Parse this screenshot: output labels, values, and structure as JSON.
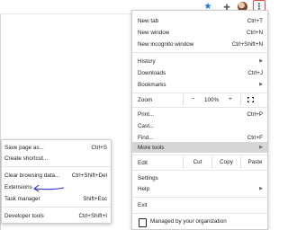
{
  "toolbar": {
    "icons": [
      "star-icon",
      "extensions-puzzle-icon",
      "profile-avatar",
      "kebab-menu-icon"
    ],
    "accent_color": "#1a73e8",
    "highlight_border_color": "#e05050"
  },
  "menu": {
    "new_tab": {
      "label": "New tab",
      "shortcut": "Ctrl+T"
    },
    "new_window": {
      "label": "New window",
      "shortcut": "Ctrl+N"
    },
    "new_incognito": {
      "label": "New incognito window",
      "shortcut": "Ctrl+Shift+N"
    },
    "history": {
      "label": "History"
    },
    "downloads": {
      "label": "Downloads",
      "shortcut": "Ctrl+J"
    },
    "bookmarks": {
      "label": "Bookmarks"
    },
    "zoom": {
      "label": "Zoom",
      "minus": "−",
      "value": "100%",
      "plus": "+"
    },
    "print": {
      "label": "Print...",
      "shortcut": "Ctrl+P"
    },
    "cast": {
      "label": "Cast..."
    },
    "find": {
      "label": "Find...",
      "shortcut": "Ctrl+F"
    },
    "more_tools": {
      "label": "More tools"
    },
    "edit": {
      "label": "Edit",
      "cut": "Cut",
      "copy": "Copy",
      "paste": "Paste"
    },
    "settings": {
      "label": "Settings"
    },
    "help": {
      "label": "Help"
    },
    "exit": {
      "label": "Exit"
    },
    "managed": {
      "label": "Managed by your organization"
    }
  },
  "submenu": {
    "save_page": {
      "label": "Save page as...",
      "shortcut": "Ctrl+S"
    },
    "create_shortcut": {
      "label": "Create shortcut..."
    },
    "clear_browsing": {
      "label": "Clear browsing data...",
      "shortcut": "Ctrl+Shift+Del"
    },
    "extensions": {
      "label": "Extensions"
    },
    "task_manager": {
      "label": "Task manager",
      "shortcut": "Shift+Esc"
    },
    "developer_tools": {
      "label": "Developer tools",
      "shortcut": "Ctrl+Shift+I"
    }
  },
  "annotation": {
    "arrow_color": "#2a2ad8"
  }
}
